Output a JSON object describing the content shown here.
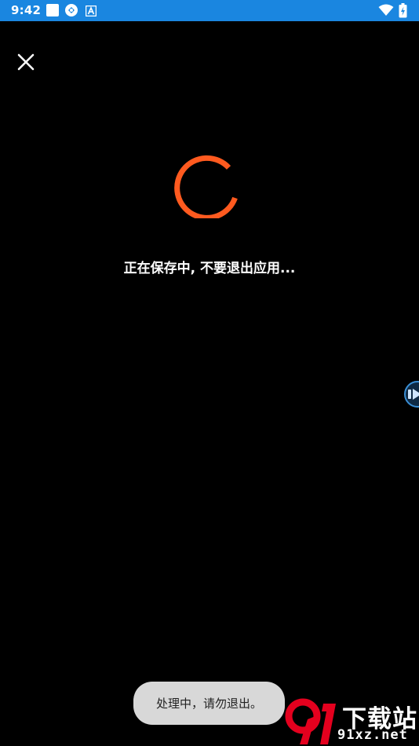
{
  "status_bar": {
    "time": "9:42",
    "icons": [
      "square-notification-icon",
      "sync-badge-icon",
      "a-letter-icon",
      "wifi-icon",
      "battery-charging-icon"
    ],
    "background": "#1a86e0"
  },
  "close": {
    "icon": "close-icon"
  },
  "progress": {
    "color": "#ff5a1f",
    "state": "indeterminate"
  },
  "message": {
    "saving": "正在保存中, 不要退出应用..."
  },
  "toast": {
    "text": "处理中，请勿退出。"
  },
  "watermark": {
    "name": "下载站",
    "url": "91xz.net",
    "accent": "#e4001e"
  }
}
